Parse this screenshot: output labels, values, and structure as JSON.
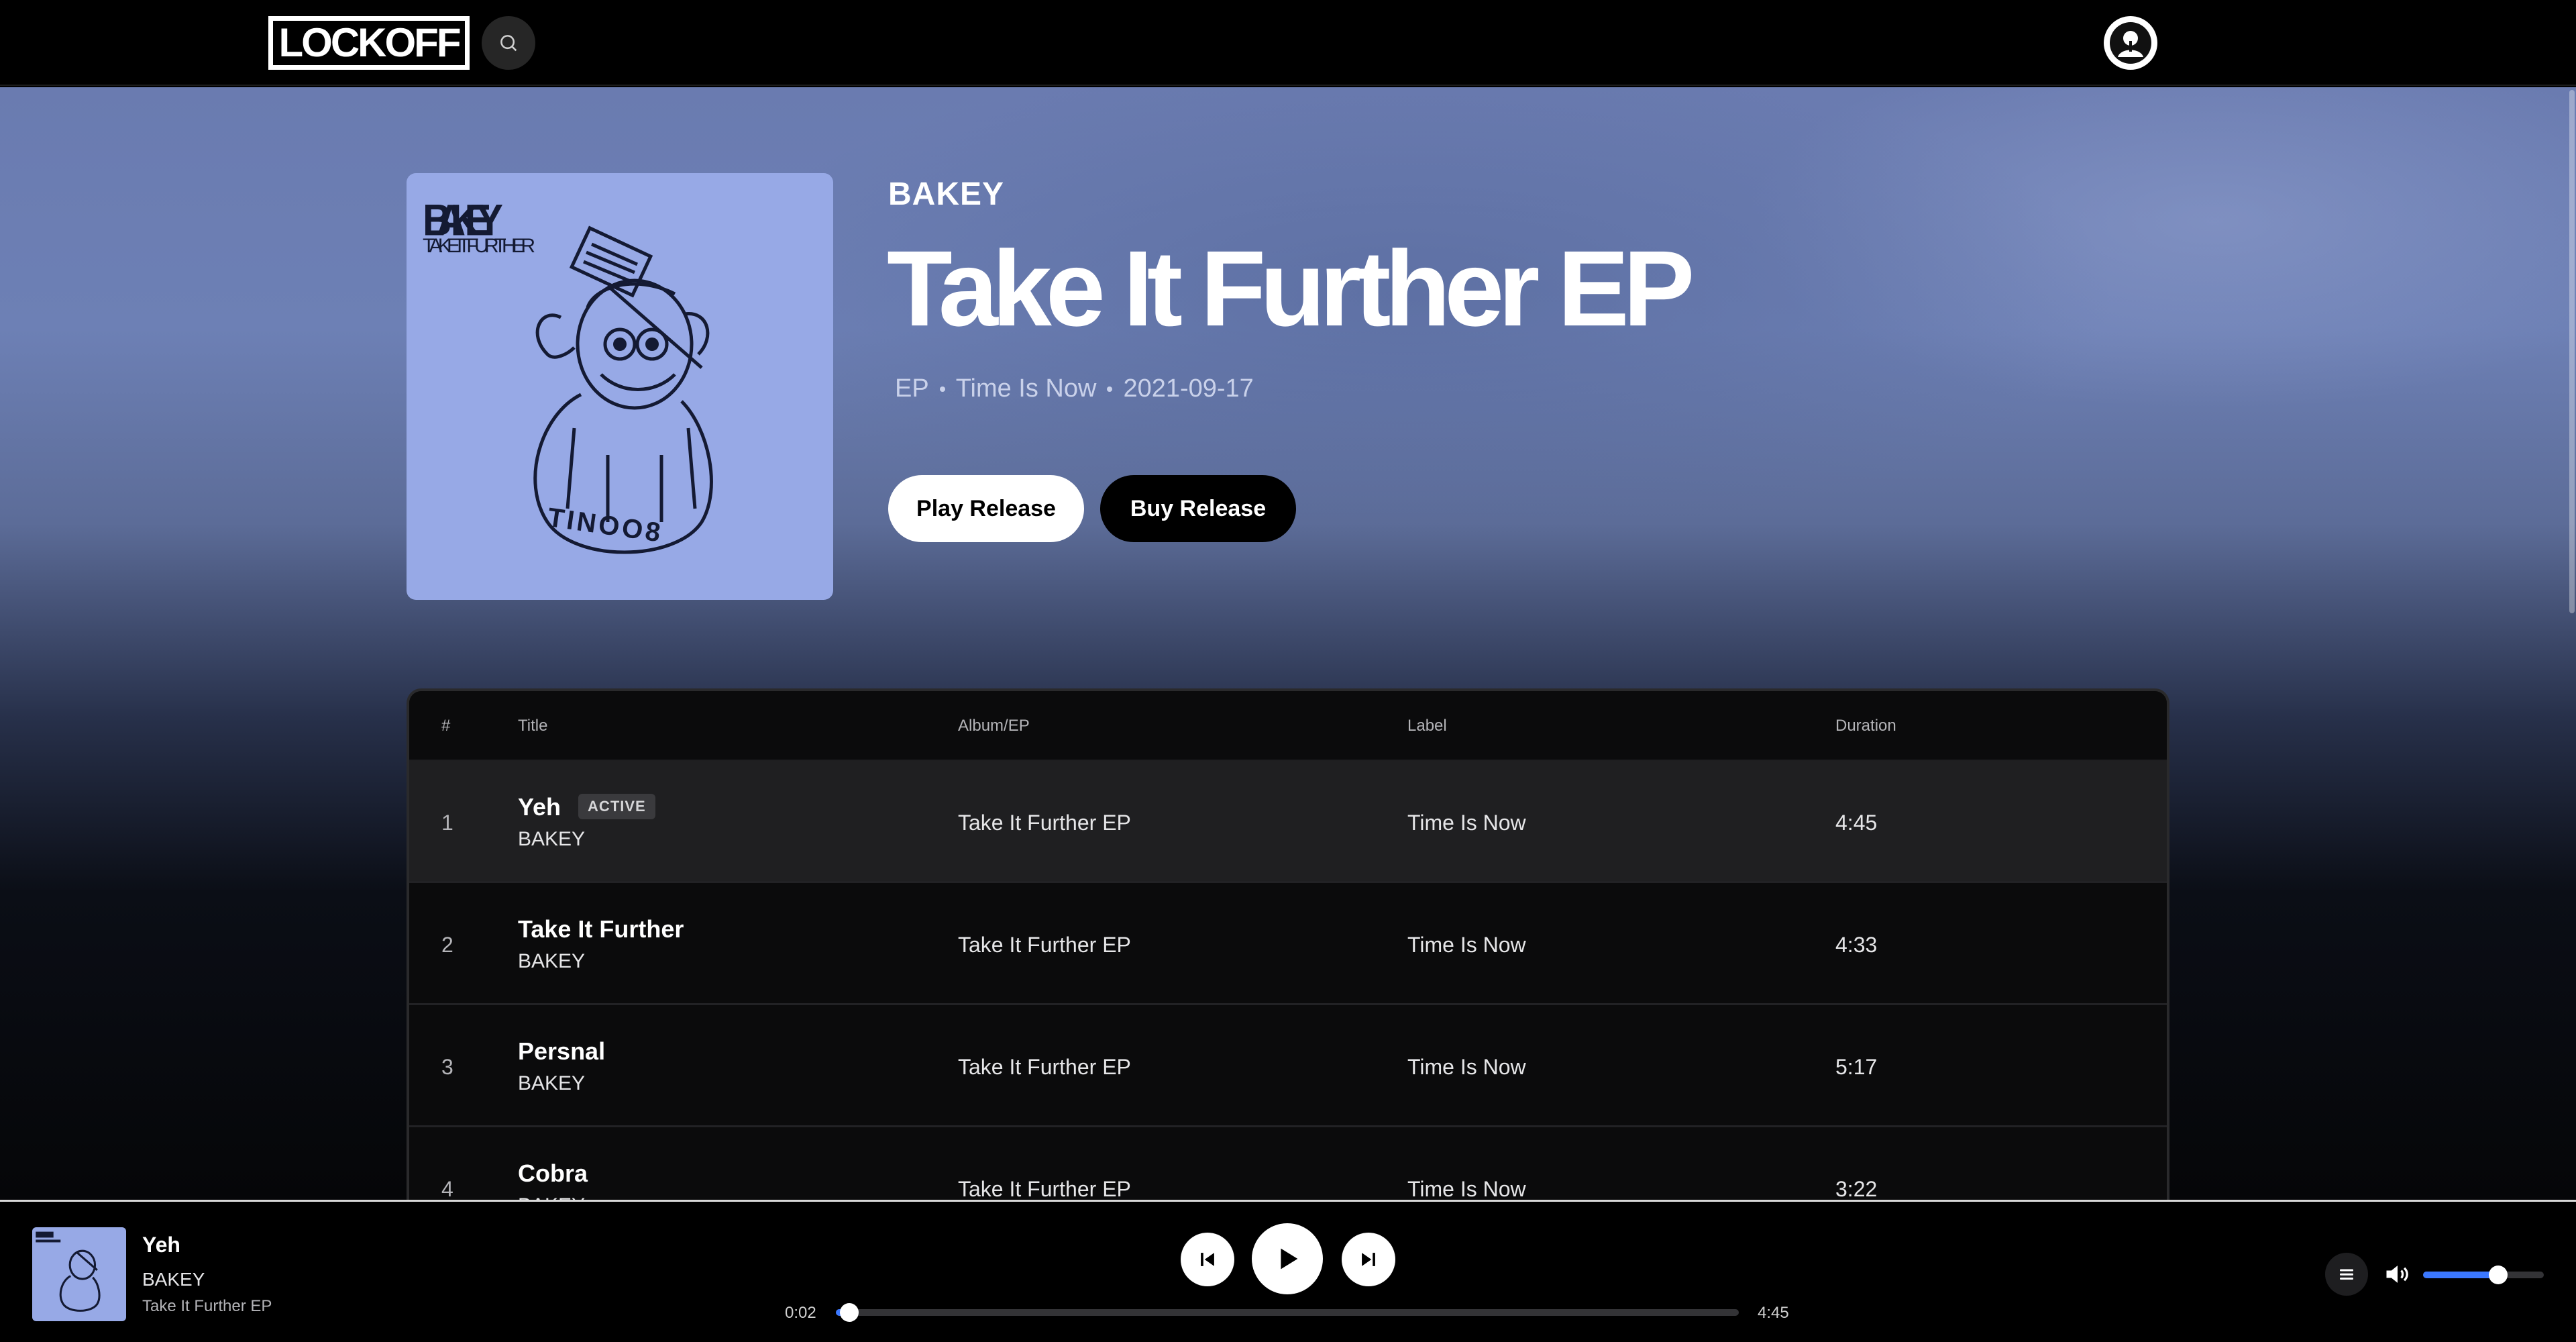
{
  "header": {
    "logo_text": "LOCKOFF",
    "icons": {
      "search": "search-icon",
      "profile": "user-avatar-icon"
    }
  },
  "release": {
    "artist": "BAKEY",
    "title": "Take It Further EP",
    "type": "EP",
    "label": "Time Is Now",
    "date": "2021-09-17",
    "cover": {
      "artist_text": "BAKEY",
      "title_text": "TAKE IT FURTHER",
      "catalog_text": "TINOO8",
      "bg_color": "#97a9e6"
    },
    "play_button": "Play Release",
    "buy_button": "Buy Release"
  },
  "table": {
    "columns": {
      "num": "#",
      "title": "Title",
      "album": "Album/EP",
      "label": "Label",
      "duration": "Duration"
    },
    "active_badge": "ACTIVE",
    "tracks": [
      {
        "num": "1",
        "title": "Yeh",
        "artist": "BAKEY",
        "album": "Take It Further EP",
        "label": "Time Is Now",
        "duration": "4:45",
        "active": true
      },
      {
        "num": "2",
        "title": "Take It Further",
        "artist": "BAKEY",
        "album": "Take It Further EP",
        "label": "Time Is Now",
        "duration": "4:33",
        "active": false
      },
      {
        "num": "3",
        "title": "Persnal",
        "artist": "BAKEY",
        "album": "Take It Further EP",
        "label": "Time Is Now",
        "duration": "5:17",
        "active": false
      },
      {
        "num": "4",
        "title": "Cobra",
        "artist": "BAKEY",
        "album": "Take It Further EP",
        "label": "Time Is Now",
        "duration": "3:22",
        "active": false
      }
    ]
  },
  "player": {
    "track_title": "Yeh",
    "track_artist": "BAKEY",
    "track_album": "Take It Further EP",
    "elapsed": "0:02",
    "total": "4:45",
    "progress_fraction": 0.015,
    "volume_fraction": 0.62,
    "accent_color": "#3b78ff",
    "icons": {
      "prev": "skip-previous-icon",
      "play": "play-icon",
      "next": "skip-next-icon",
      "queue": "queue-list-icon",
      "volume": "volume-icon"
    }
  }
}
